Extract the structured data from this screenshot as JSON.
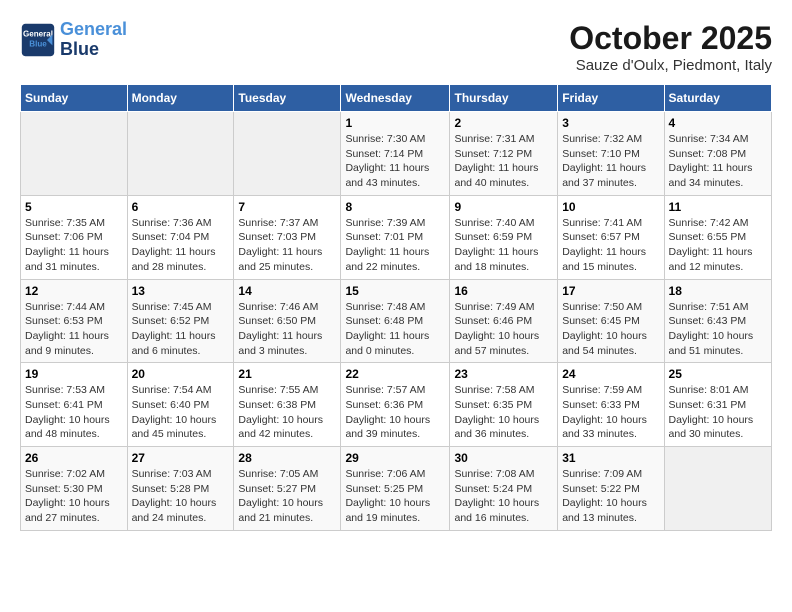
{
  "header": {
    "logo_line1": "General",
    "logo_line2": "Blue",
    "month": "October 2025",
    "location": "Sauze d'Oulx, Piedmont, Italy"
  },
  "weekdays": [
    "Sunday",
    "Monday",
    "Tuesday",
    "Wednesday",
    "Thursday",
    "Friday",
    "Saturday"
  ],
  "weeks": [
    [
      {
        "day": "",
        "info": ""
      },
      {
        "day": "",
        "info": ""
      },
      {
        "day": "",
        "info": ""
      },
      {
        "day": "1",
        "info": "Sunrise: 7:30 AM\nSunset: 7:14 PM\nDaylight: 11 hours\nand 43 minutes."
      },
      {
        "day": "2",
        "info": "Sunrise: 7:31 AM\nSunset: 7:12 PM\nDaylight: 11 hours\nand 40 minutes."
      },
      {
        "day": "3",
        "info": "Sunrise: 7:32 AM\nSunset: 7:10 PM\nDaylight: 11 hours\nand 37 minutes."
      },
      {
        "day": "4",
        "info": "Sunrise: 7:34 AM\nSunset: 7:08 PM\nDaylight: 11 hours\nand 34 minutes."
      }
    ],
    [
      {
        "day": "5",
        "info": "Sunrise: 7:35 AM\nSunset: 7:06 PM\nDaylight: 11 hours\nand 31 minutes."
      },
      {
        "day": "6",
        "info": "Sunrise: 7:36 AM\nSunset: 7:04 PM\nDaylight: 11 hours\nand 28 minutes."
      },
      {
        "day": "7",
        "info": "Sunrise: 7:37 AM\nSunset: 7:03 PM\nDaylight: 11 hours\nand 25 minutes."
      },
      {
        "day": "8",
        "info": "Sunrise: 7:39 AM\nSunset: 7:01 PM\nDaylight: 11 hours\nand 22 minutes."
      },
      {
        "day": "9",
        "info": "Sunrise: 7:40 AM\nSunset: 6:59 PM\nDaylight: 11 hours\nand 18 minutes."
      },
      {
        "day": "10",
        "info": "Sunrise: 7:41 AM\nSunset: 6:57 PM\nDaylight: 11 hours\nand 15 minutes."
      },
      {
        "day": "11",
        "info": "Sunrise: 7:42 AM\nSunset: 6:55 PM\nDaylight: 11 hours\nand 12 minutes."
      }
    ],
    [
      {
        "day": "12",
        "info": "Sunrise: 7:44 AM\nSunset: 6:53 PM\nDaylight: 11 hours\nand 9 minutes."
      },
      {
        "day": "13",
        "info": "Sunrise: 7:45 AM\nSunset: 6:52 PM\nDaylight: 11 hours\nand 6 minutes."
      },
      {
        "day": "14",
        "info": "Sunrise: 7:46 AM\nSunset: 6:50 PM\nDaylight: 11 hours\nand 3 minutes."
      },
      {
        "day": "15",
        "info": "Sunrise: 7:48 AM\nSunset: 6:48 PM\nDaylight: 11 hours\nand 0 minutes."
      },
      {
        "day": "16",
        "info": "Sunrise: 7:49 AM\nSunset: 6:46 PM\nDaylight: 10 hours\nand 57 minutes."
      },
      {
        "day": "17",
        "info": "Sunrise: 7:50 AM\nSunset: 6:45 PM\nDaylight: 10 hours\nand 54 minutes."
      },
      {
        "day": "18",
        "info": "Sunrise: 7:51 AM\nSunset: 6:43 PM\nDaylight: 10 hours\nand 51 minutes."
      }
    ],
    [
      {
        "day": "19",
        "info": "Sunrise: 7:53 AM\nSunset: 6:41 PM\nDaylight: 10 hours\nand 48 minutes."
      },
      {
        "day": "20",
        "info": "Sunrise: 7:54 AM\nSunset: 6:40 PM\nDaylight: 10 hours\nand 45 minutes."
      },
      {
        "day": "21",
        "info": "Sunrise: 7:55 AM\nSunset: 6:38 PM\nDaylight: 10 hours\nand 42 minutes."
      },
      {
        "day": "22",
        "info": "Sunrise: 7:57 AM\nSunset: 6:36 PM\nDaylight: 10 hours\nand 39 minutes."
      },
      {
        "day": "23",
        "info": "Sunrise: 7:58 AM\nSunset: 6:35 PM\nDaylight: 10 hours\nand 36 minutes."
      },
      {
        "day": "24",
        "info": "Sunrise: 7:59 AM\nSunset: 6:33 PM\nDaylight: 10 hours\nand 33 minutes."
      },
      {
        "day": "25",
        "info": "Sunrise: 8:01 AM\nSunset: 6:31 PM\nDaylight: 10 hours\nand 30 minutes."
      }
    ],
    [
      {
        "day": "26",
        "info": "Sunrise: 7:02 AM\nSunset: 5:30 PM\nDaylight: 10 hours\nand 27 minutes."
      },
      {
        "day": "27",
        "info": "Sunrise: 7:03 AM\nSunset: 5:28 PM\nDaylight: 10 hours\nand 24 minutes."
      },
      {
        "day": "28",
        "info": "Sunrise: 7:05 AM\nSunset: 5:27 PM\nDaylight: 10 hours\nand 21 minutes."
      },
      {
        "day": "29",
        "info": "Sunrise: 7:06 AM\nSunset: 5:25 PM\nDaylight: 10 hours\nand 19 minutes."
      },
      {
        "day": "30",
        "info": "Sunrise: 7:08 AM\nSunset: 5:24 PM\nDaylight: 10 hours\nand 16 minutes."
      },
      {
        "day": "31",
        "info": "Sunrise: 7:09 AM\nSunset: 5:22 PM\nDaylight: 10 hours\nand 13 minutes."
      },
      {
        "day": "",
        "info": ""
      }
    ]
  ]
}
